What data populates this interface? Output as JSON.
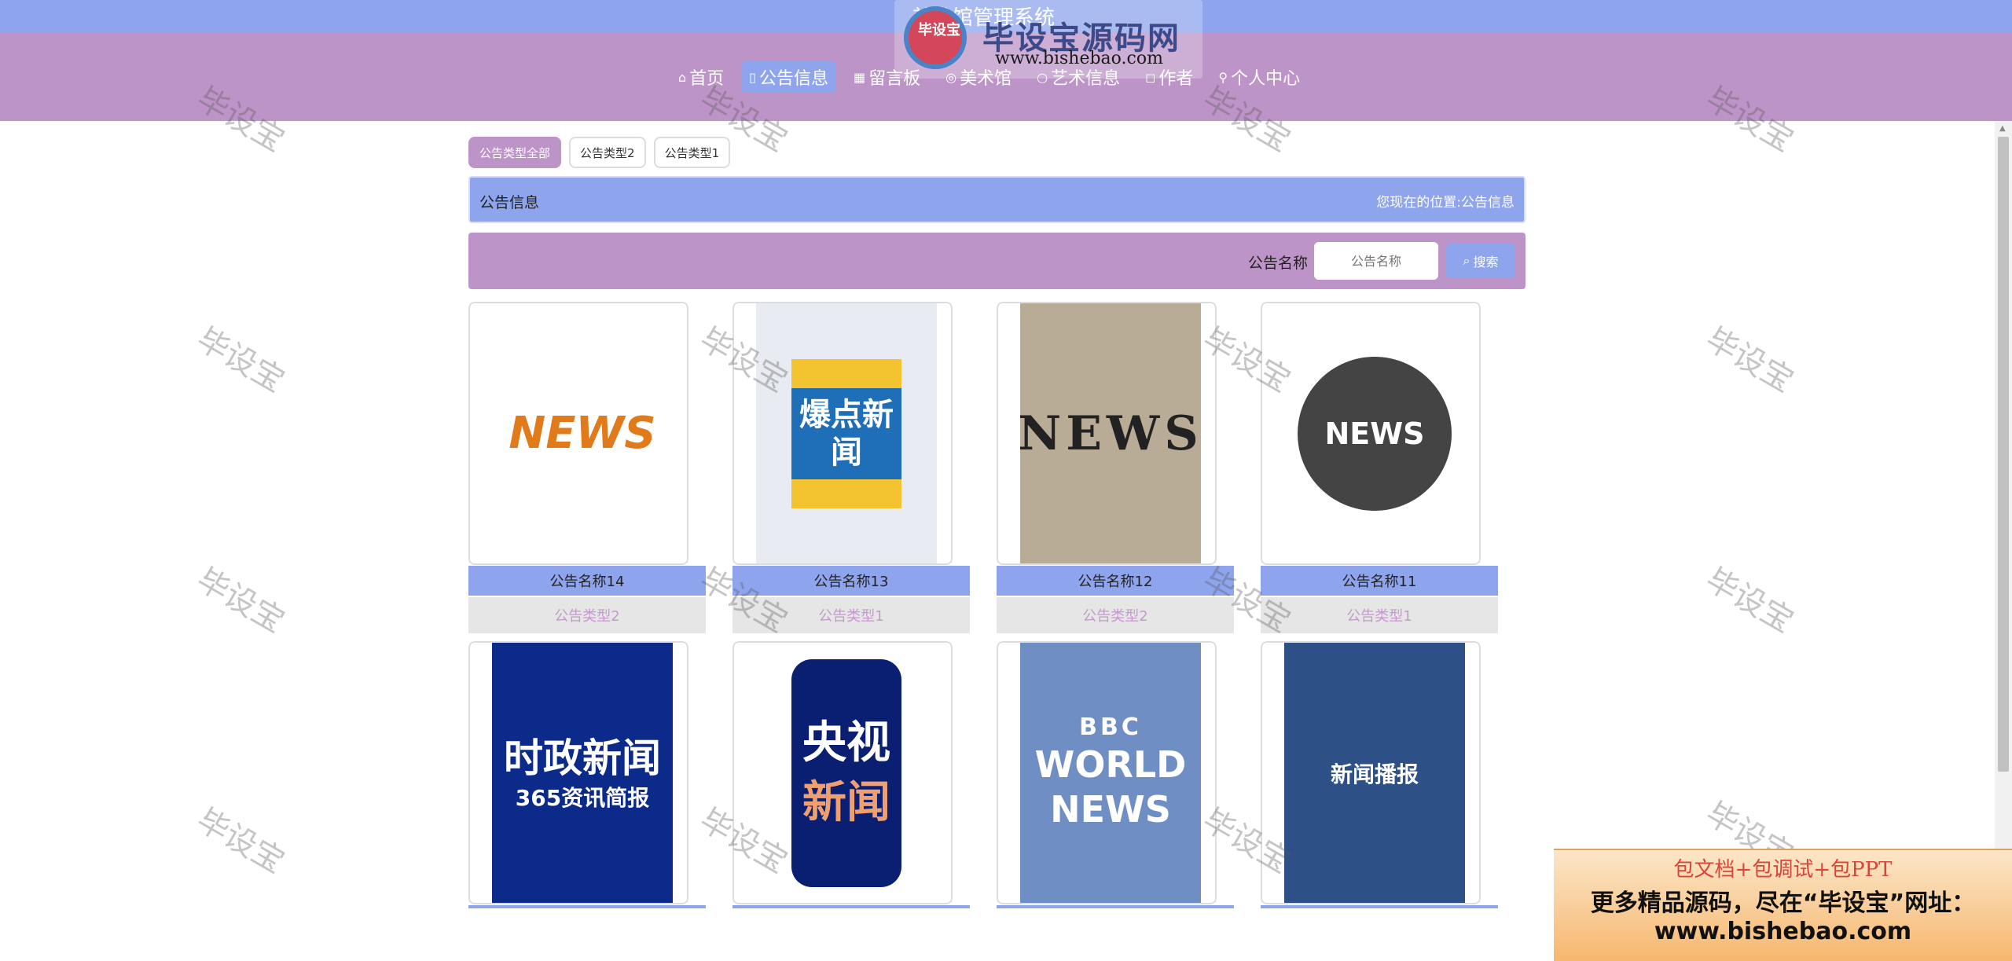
{
  "header": {
    "title": "美术馆管理系统"
  },
  "nav": [
    {
      "icon": "home-icon",
      "glyph": "⌂",
      "label": "首页",
      "active": false
    },
    {
      "icon": "document-icon",
      "glyph": "▯",
      "label": "公告信息",
      "active": true
    },
    {
      "icon": "grid-icon",
      "glyph": "▦",
      "label": "留言板",
      "active": false
    },
    {
      "icon": "gallery-icon",
      "glyph": "◎",
      "label": "美术馆",
      "active": false
    },
    {
      "icon": "art-icon",
      "glyph": "○",
      "label": "艺术信息",
      "active": false
    },
    {
      "icon": "author-icon",
      "glyph": "◻",
      "label": "作者",
      "active": false
    },
    {
      "icon": "user-icon",
      "glyph": "⚲",
      "label": "个人中心",
      "active": false
    }
  ],
  "watermark_logo": {
    "badge": "毕设宝",
    "brand": "毕设宝源码网",
    "url": "www.bishebao.com"
  },
  "categories": [
    "公告类型全部",
    "公告类型2",
    "公告类型1"
  ],
  "section": {
    "title": "公告信息",
    "location_label": "您现在的位置:",
    "location_value": "公告信息"
  },
  "search": {
    "label": "公告名称",
    "placeholder": "公告名称",
    "button": "搜索"
  },
  "cards_row1": [
    {
      "name": "公告名称14",
      "type": "公告类型2",
      "image_text": "NEWS"
    },
    {
      "name": "公告名称13",
      "type": "公告类型1",
      "image_text": "爆点新闻"
    },
    {
      "name": "公告名称12",
      "type": "公告类型2",
      "image_text": "NEWS"
    },
    {
      "name": "公告名称11",
      "type": "公告类型1",
      "image_text": "NEWS"
    }
  ],
  "cards_row2": [
    {
      "image_text": "时政新闻",
      "image_sub": "365资讯简报"
    },
    {
      "image_text": "央视",
      "image_sub": "新闻"
    },
    {
      "image_text": "BBC",
      "image_sub": "WORLD NEWS"
    },
    {
      "image_text": "新闻播报"
    }
  ],
  "watermark_text": "毕设宝",
  "ad": {
    "line1": "包文档+包调试+包PPT",
    "line2": "更多精品源码，尽在“毕设宝”网址：",
    "line3": "www.bishebao.com"
  },
  "colors": {
    "primary": "#8ea5ee",
    "secondary": "#bd94c7",
    "type_text": "#c39acb"
  }
}
